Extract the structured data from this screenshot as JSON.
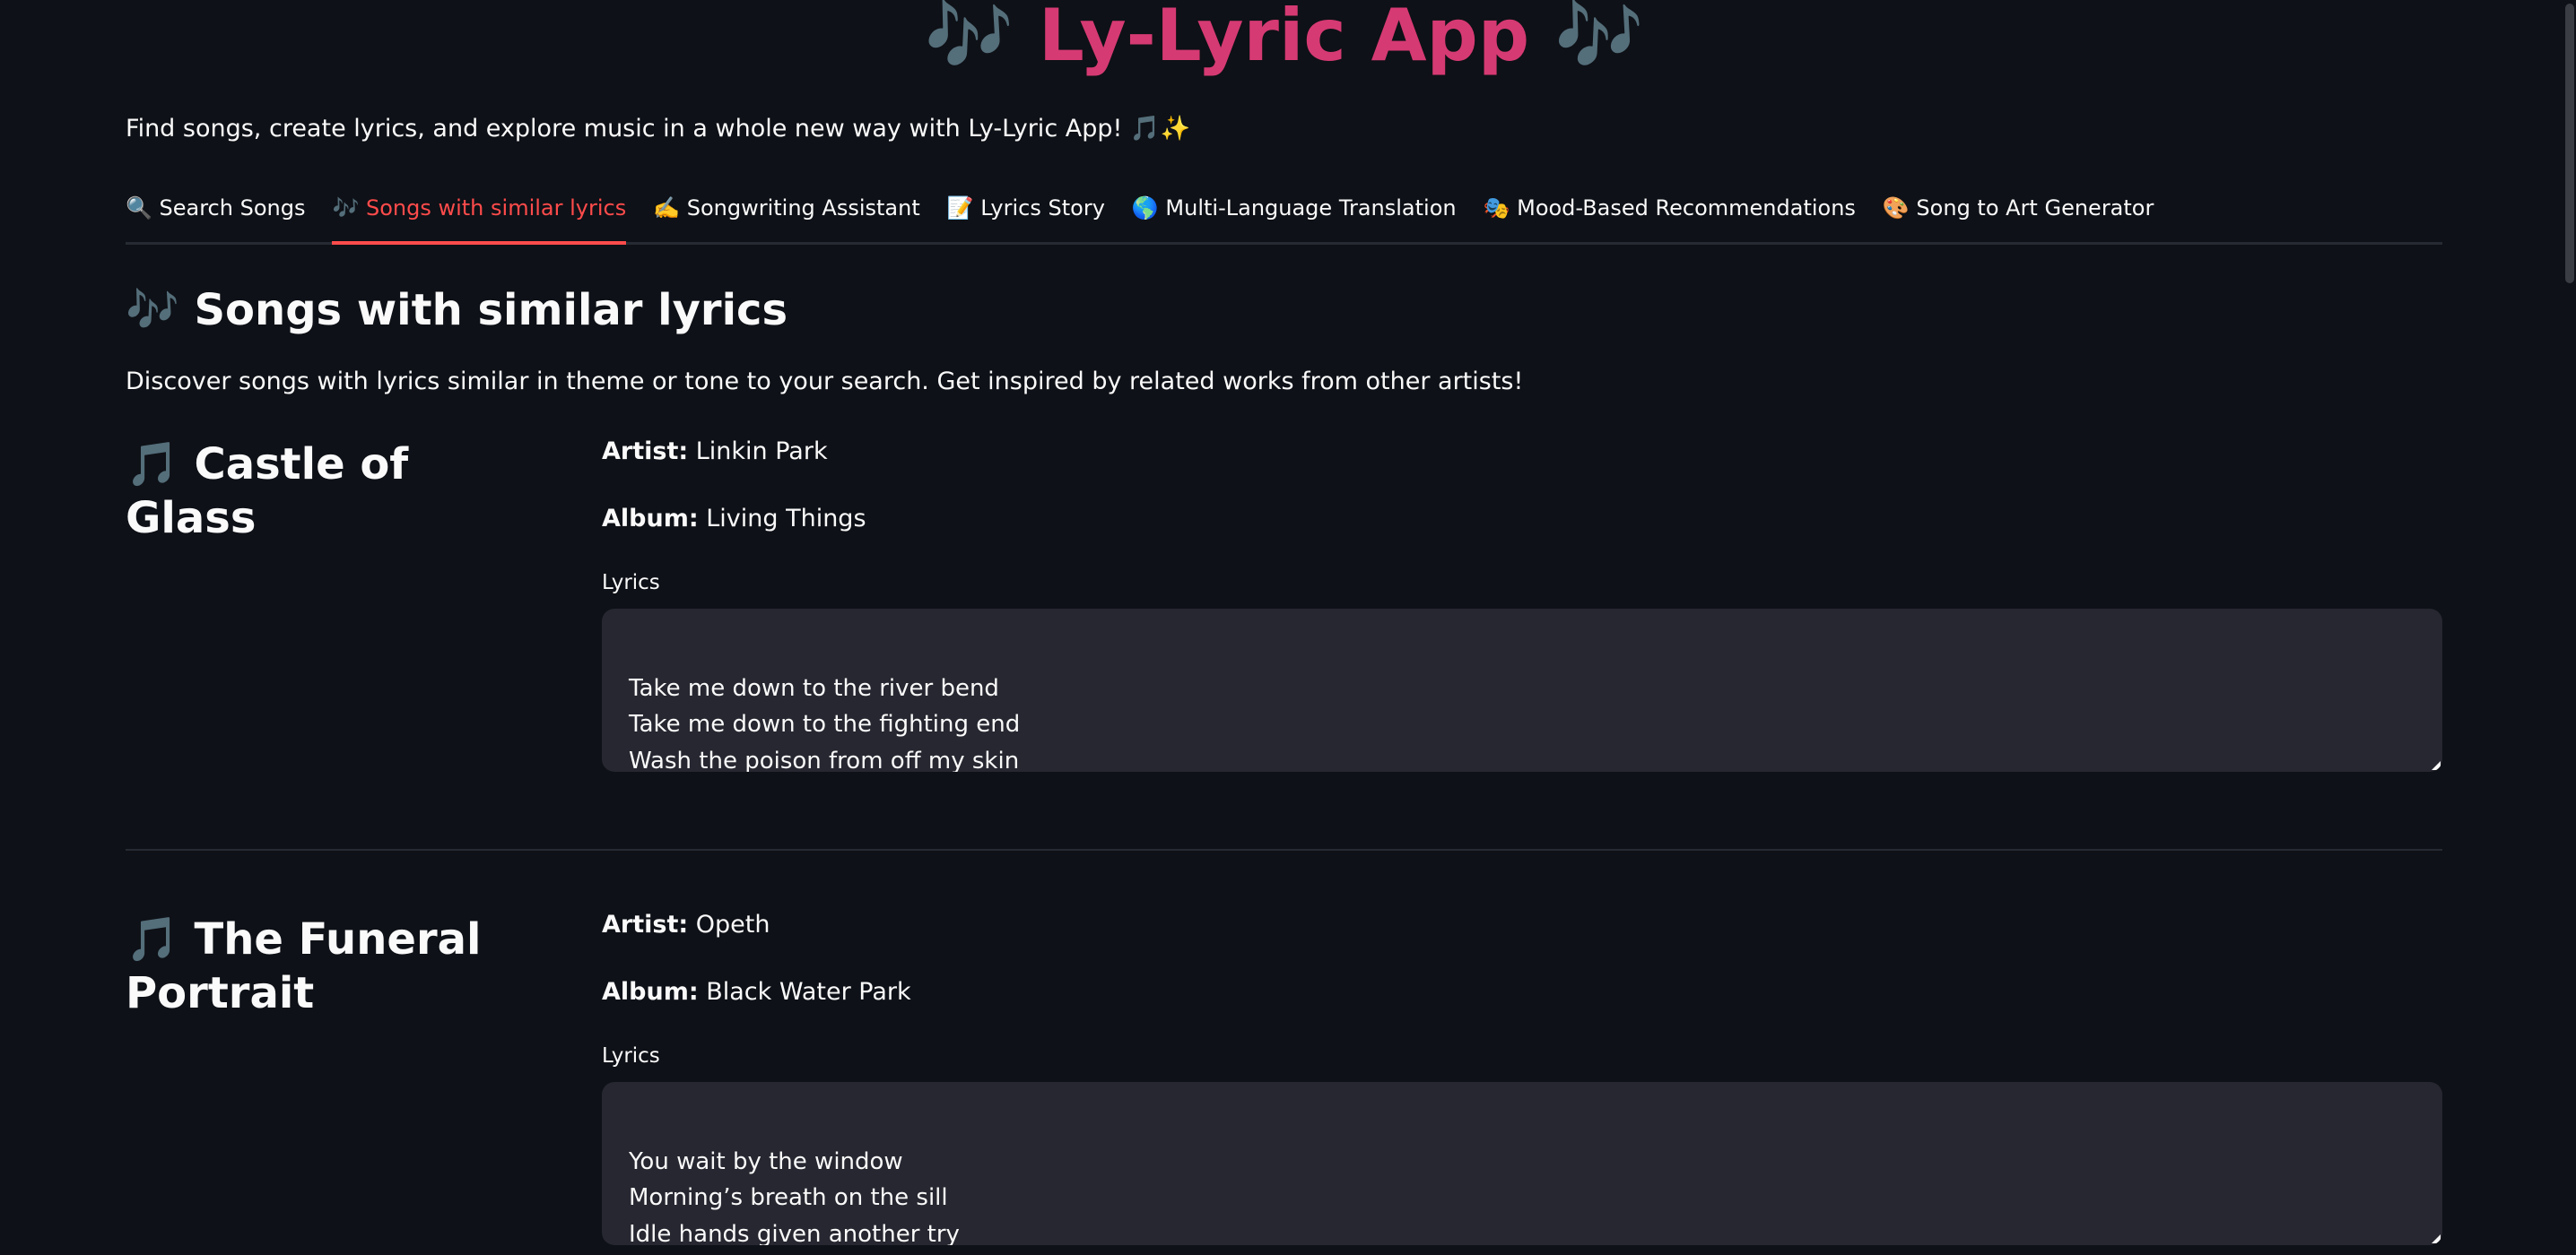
{
  "header": {
    "title": "🎶 Ly-Lyric App 🎶",
    "tagline": "Find songs, create lyrics, and explore music in a whole new way with Ly-Lyric App! 🎵✨"
  },
  "tabs": [
    {
      "label": "🔍 Search Songs",
      "active": false
    },
    {
      "label": "🎶 Songs with similar lyrics",
      "active": true
    },
    {
      "label": "✍️ Songwriting Assistant",
      "active": false
    },
    {
      "label": "📝 Lyrics Story",
      "active": false
    },
    {
      "label": "🌎 Multi-Language Translation",
      "active": false
    },
    {
      "label": "🎭 Mood-Based Recommendations",
      "active": false
    },
    {
      "label": "🎨 Song to Art Generator",
      "active": false
    }
  ],
  "section": {
    "title": "🎶 Songs with similar lyrics",
    "description": "Discover songs with lyrics similar in theme or tone to your search. Get inspired by related works from other artists!"
  },
  "labels": {
    "artist": "Artist:",
    "album": "Album:",
    "lyrics": "Lyrics"
  },
  "songs": [
    {
      "title": "🎵 Castle of Glass",
      "artist": "Linkin Park",
      "album": "Living Things",
      "lyrics": "Take me down to the river bend\nTake me down to the fighting end\nWash the poison from off my skin\nShow me how to be whole again"
    },
    {
      "title": "🎵 The Funeral Portrait",
      "artist": "Opeth",
      "album": "Black Water Park",
      "lyrics": "You wait by the window\nMorning’s breath on the sill\nIdle hands given another try\nSo you wait and you savour the moment"
    }
  ],
  "colors": {
    "background": "#0e1117",
    "accent": "#ff4b4b",
    "title": "#d63a73",
    "textarea": "#262730"
  }
}
